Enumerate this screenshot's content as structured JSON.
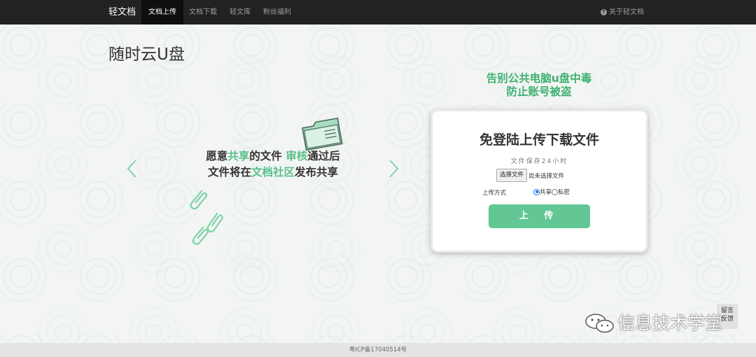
{
  "navbar": {
    "brand": "轻文档",
    "items": [
      {
        "label": "文档上传",
        "active": true
      },
      {
        "label": "文档下载",
        "active": false
      },
      {
        "label": "轻文库",
        "active": false
      },
      {
        "label": "粉丝福利",
        "active": false
      }
    ],
    "about": "关于轻文档"
  },
  "page": {
    "title": "随时云U盘"
  },
  "carousel": {
    "line1": {
      "a": "愿意",
      "b": "共享",
      "c": "的文件 ",
      "d": "审核",
      "e": "通过后"
    },
    "line2": {
      "a": "文件将在",
      "b": "文档社区",
      "c": "发布共享"
    }
  },
  "tagline": {
    "line1": "告别公共电脑u盘中毒",
    "line2": "防止账号被盗"
  },
  "upload_card": {
    "title": "免登陆上传下载文件",
    "note": "文件保存24小时",
    "file_button": "选择文件",
    "file_status": "尚未选择文件",
    "mode_label": "上传方式",
    "mode_options": [
      {
        "label": "共享",
        "checked": true
      },
      {
        "label": "私密",
        "checked": false
      }
    ],
    "submit": "上 传"
  },
  "watermark": "信息技术学堂",
  "feedback": {
    "line1": "留言",
    "line2": "反馈"
  },
  "footer": "粤ICP备17040514号",
  "colors": {
    "accent_green": "#62c795",
    "highlight_green": "#5bbf8a",
    "navbar": "#222222"
  }
}
